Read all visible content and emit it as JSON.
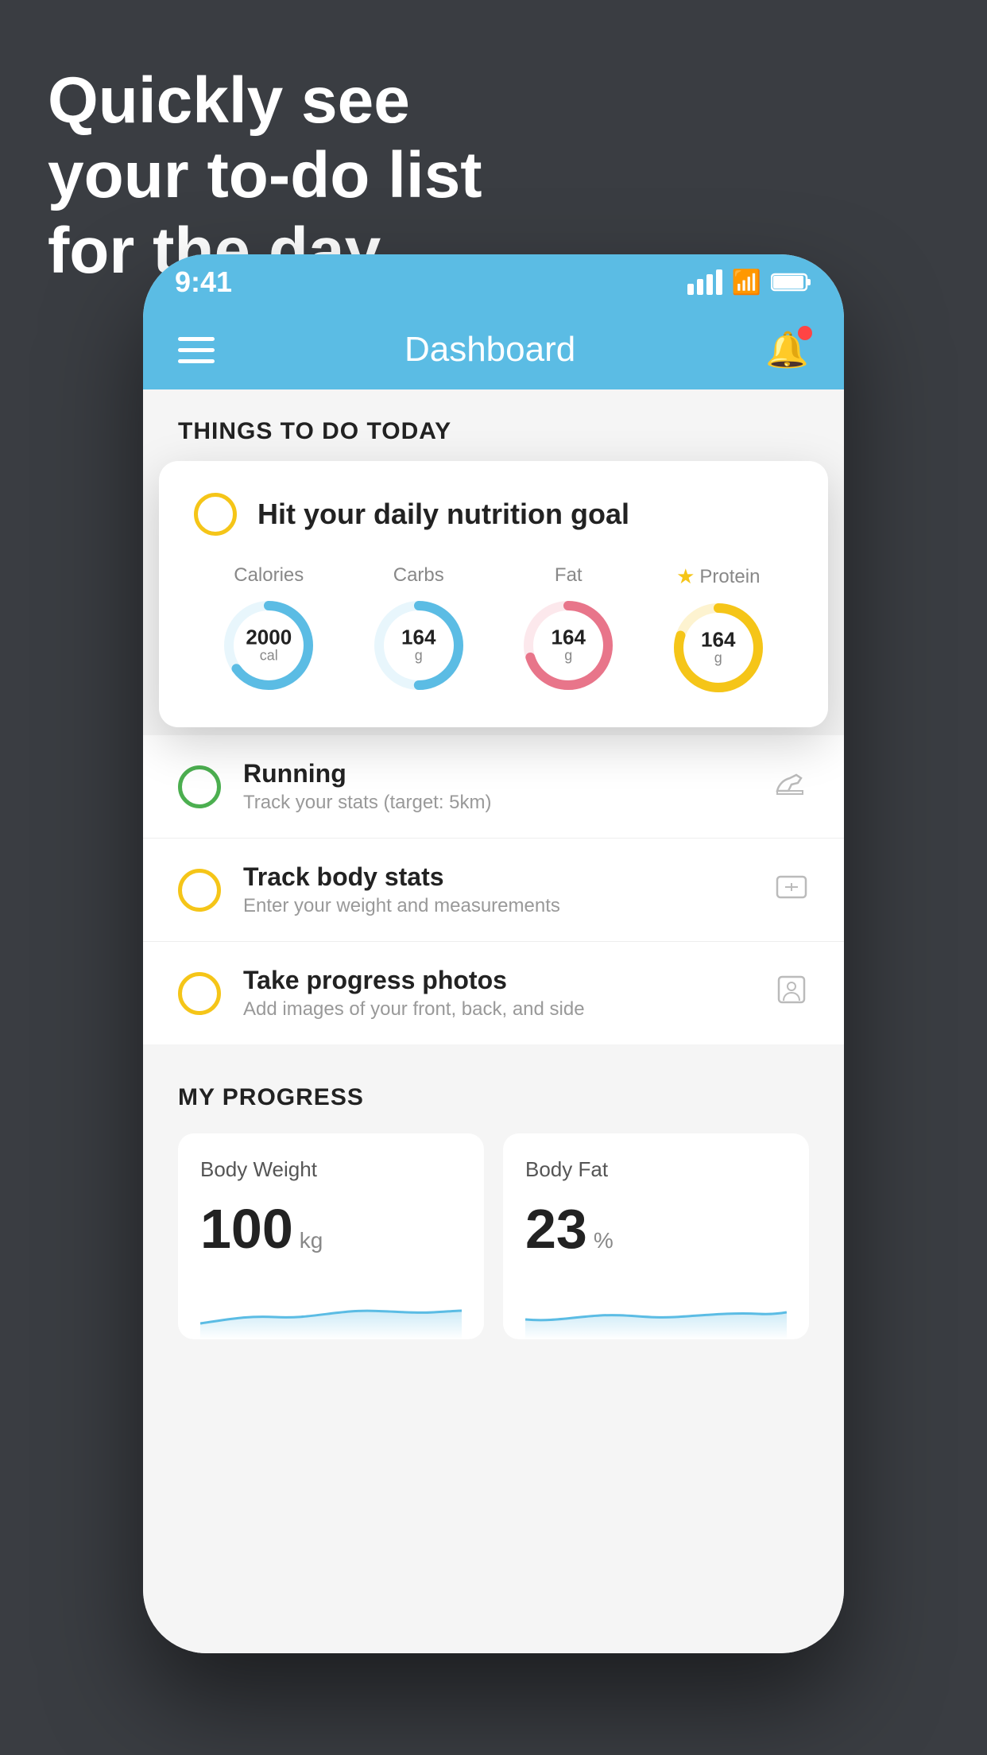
{
  "hero": {
    "line1": "Quickly see",
    "line2": "your to-do list",
    "line3": "for the day."
  },
  "statusBar": {
    "time": "9:41"
  },
  "navbar": {
    "title": "Dashboard"
  },
  "thingsToDo": {
    "sectionTitle": "THINGS TO DO TODAY",
    "floatingCard": {
      "title": "Hit your daily nutrition goal",
      "nutrition": [
        {
          "label": "Calories",
          "value": "2000",
          "unit": "cal",
          "color": "#5bbce4",
          "progress": 0.65,
          "star": false
        },
        {
          "label": "Carbs",
          "value": "164",
          "unit": "g",
          "color": "#5bbce4",
          "progress": 0.5,
          "star": false
        },
        {
          "label": "Fat",
          "value": "164",
          "unit": "g",
          "color": "#e8758a",
          "progress": 0.7,
          "star": false
        },
        {
          "label": "Protein",
          "value": "164",
          "unit": "g",
          "color": "#f5c518",
          "progress": 0.8,
          "star": true
        }
      ]
    },
    "items": [
      {
        "id": "running",
        "title": "Running",
        "subtitle": "Track your stats (target: 5km)",
        "circleType": "green",
        "icon": "shoe"
      },
      {
        "id": "body-stats",
        "title": "Track body stats",
        "subtitle": "Enter your weight and measurements",
        "circleType": "yellow",
        "icon": "scale"
      },
      {
        "id": "progress-photos",
        "title": "Take progress photos",
        "subtitle": "Add images of your front, back, and side",
        "circleType": "yellow",
        "icon": "person"
      }
    ]
  },
  "progress": {
    "sectionTitle": "MY PROGRESS",
    "cards": [
      {
        "title": "Body Weight",
        "value": "100",
        "unit": "kg"
      },
      {
        "title": "Body Fat",
        "value": "23",
        "unit": "%"
      }
    ]
  }
}
